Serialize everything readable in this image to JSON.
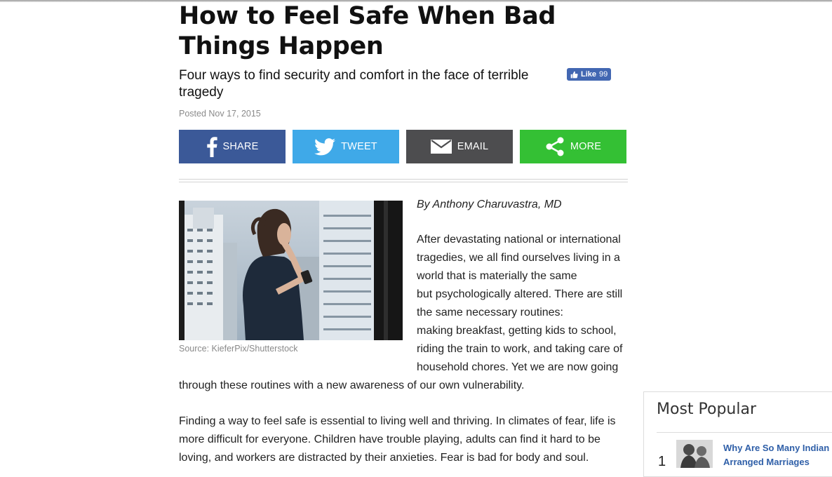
{
  "article": {
    "title": "How to Feel Safe When Bad Things Happen",
    "subtitle": "Four ways to find security and comfort in the face of terrible tragedy",
    "posted": "Posted Nov 17, 2015",
    "like_label": "Like",
    "like_count": "99",
    "byline": "By Anthony Charuvastra, MD",
    "image_caption": "Source: KieferPix/Shutterstock",
    "para1_lines": [
      "After devastating national or international",
      "tragedies, we all find ourselves living in a",
      "world that is materially the same",
      "but psychologically altered. There are still",
      "the same necessary routines:",
      "making breakfast, getting kids to school,",
      "riding the train to work, and taking care of",
      "household chores. Yet we are now going"
    ],
    "para1_tail": "through these routines with a new awareness of our own vulnerability.",
    "para2_lines": [
      "Finding a way to feel safe is essential to living well and thriving. In climates of fear, life is",
      "more difficult for everyone. Children have trouble playing, adults can find it hard to be",
      "loving, and workers are distracted by their anxieties. Fear is bad for body and soul."
    ]
  },
  "share": {
    "facebook": {
      "label": "SHARE",
      "icon": "facebook-icon",
      "color": "#3b5998"
    },
    "twitter": {
      "label": "TWEET",
      "icon": "twitter-icon",
      "color": "#3fa9e8"
    },
    "email": {
      "label": "EMAIL",
      "icon": "envelope-icon",
      "color": "#4d4d4f"
    },
    "more": {
      "label": "MORE",
      "icon": "share-icon",
      "color": "#34c034"
    }
  },
  "sidebar": {
    "title": "Most Popular",
    "items": [
      {
        "rank": "1",
        "title": "Why Are So Many Indian Arranged Marriages"
      }
    ]
  },
  "colors": {
    "link": "#2f5fa8",
    "facebook_like": "#4267b2"
  }
}
